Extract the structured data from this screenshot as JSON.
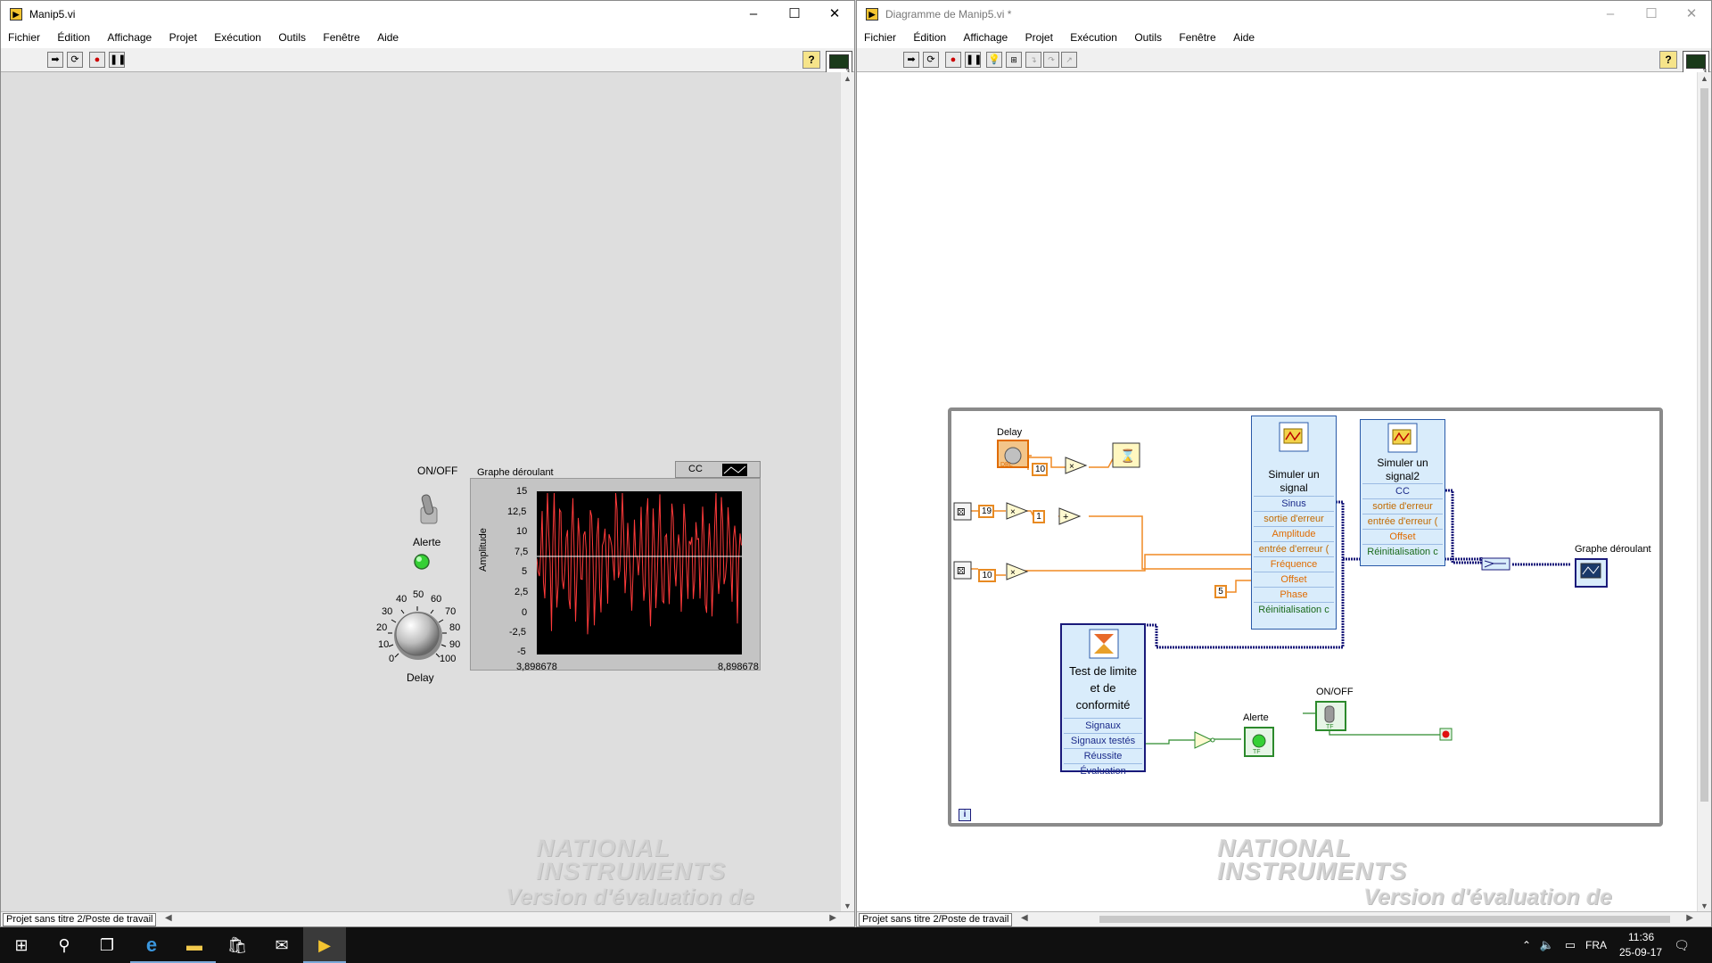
{
  "front_panel": {
    "title": "Manip5.vi",
    "menu": [
      "Fichier",
      "Édition",
      "Affichage",
      "Projet",
      "Exécution",
      "Outils",
      "Fenêtre",
      "Aide"
    ],
    "controls": {
      "switch_label": "ON/OFF",
      "led_label": "Alerte",
      "knob_label": "Delay",
      "knob_ticks": [
        "0",
        "10",
        "20",
        "30",
        "40",
        "50",
        "60",
        "70",
        "80",
        "90",
        "100"
      ]
    },
    "chart": {
      "label": "Graphe déroulant",
      "plot_legend": "CC",
      "ylabel": "Amplitude",
      "y_ticks": [
        "15",
        "12,5",
        "10",
        "7,5",
        "5",
        "2,5",
        "0",
        "-2,5",
        "-5"
      ],
      "x_min_label": "3,898678",
      "x_max_label": "8,898678"
    },
    "project": "Projet sans titre 2/Poste de travail"
  },
  "block_diagram": {
    "title": "Diagramme de Manip5.vi *",
    "menu": [
      "Fichier",
      "Édition",
      "Affichage",
      "Projet",
      "Exécution",
      "Outils",
      "Fenêtre",
      "Aide"
    ],
    "labels": {
      "delay": "Delay",
      "chart": "Graphe déroulant",
      "onoff": "ON/OFF",
      "alerte": "Alerte",
      "loop_index": "i"
    },
    "constants": {
      "c19": "19",
      "c1": "1",
      "c10a": "10",
      "c10b": "10",
      "c5": "5"
    },
    "sim1": {
      "title": "Simuler un signal",
      "terminals": [
        "Sinus",
        "sortie d'erreur",
        "Amplitude",
        "entrée d'erreur (",
        "Fréquence",
        "Offset",
        "Phase",
        "Réinitialisation c"
      ]
    },
    "sim2": {
      "title": "Simuler un signal2",
      "terminals": [
        "CC",
        "sortie d'erreur",
        "entrée d'erreur (",
        "Offset",
        "Réinitialisation c"
      ]
    },
    "limit": {
      "title": "Test de limite et de conformité",
      "terminals": [
        "Signaux",
        "Signaux testés",
        "Réussite",
        "Évaluation"
      ]
    },
    "project": "Projet sans titre 2/Poste de travail"
  },
  "watermark": {
    "line1": "NATIONAL",
    "line2": "INSTRUMENTS",
    "line3": "Version d'évaluation de LabVIEW"
  },
  "tray": {
    "lang": "FRA",
    "time": "11:36",
    "date": "25-09-17"
  },
  "colors": {
    "orange_wire": "#f08a24",
    "blue_wire": "#1a1a7a",
    "green_wire": "#2c8a2c",
    "loop": "#8a8a8a"
  }
}
